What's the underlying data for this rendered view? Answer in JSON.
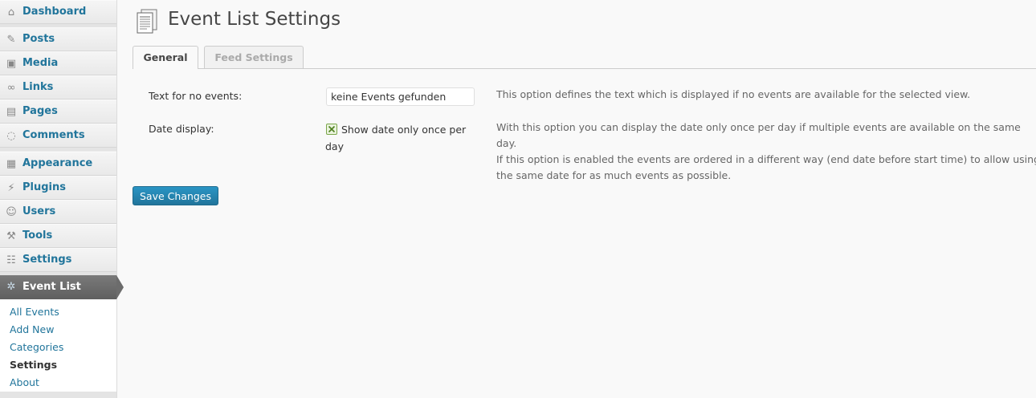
{
  "sidebar": {
    "items": [
      {
        "label": "Dashboard",
        "icon": "dashboard-icon"
      },
      {
        "label": "Posts",
        "icon": "posts-icon"
      },
      {
        "label": "Media",
        "icon": "media-icon"
      },
      {
        "label": "Links",
        "icon": "links-icon"
      },
      {
        "label": "Pages",
        "icon": "pages-icon"
      },
      {
        "label": "Comments",
        "icon": "comments-icon"
      },
      {
        "label": "Appearance",
        "icon": "appearance-icon"
      },
      {
        "label": "Plugins",
        "icon": "plugins-icon"
      },
      {
        "label": "Users",
        "icon": "users-icon"
      },
      {
        "label": "Tools",
        "icon": "tools-icon"
      },
      {
        "label": "Settings",
        "icon": "settings-icon"
      }
    ],
    "active": {
      "label": "Event List",
      "icon": "gear-icon"
    },
    "submenu": [
      {
        "label": "All Events"
      },
      {
        "label": "Add New"
      },
      {
        "label": "Categories"
      },
      {
        "label": "Settings",
        "current": true
      },
      {
        "label": "About"
      }
    ]
  },
  "page": {
    "title": "Event List Settings",
    "icon": "page-settings-icon"
  },
  "tabs": [
    {
      "label": "General",
      "active": true
    },
    {
      "label": "Feed Settings",
      "active": false
    }
  ],
  "fields": {
    "no_events": {
      "label": "Text for no events:",
      "value": "keine Events gefunden",
      "description": "This option defines the text which is displayed if no events are available for the selected view."
    },
    "date_display": {
      "label": "Date display:",
      "checkbox_label": "Show date only once per day",
      "checked": true,
      "description_lines": [
        "With this option you can display the date only once per day if multiple events are available on the same day.",
        "If this option is enabled the events are ordered in a different way (end date before start time) to allow using",
        "the same date for as much events as possible."
      ]
    }
  },
  "save_button": {
    "label": "Save Changes"
  },
  "colors": {
    "link": "#21759b",
    "primary_button": "#21759b",
    "sidebar_bg": "#ececec",
    "active_menu_bg": "#6d6d6d"
  }
}
